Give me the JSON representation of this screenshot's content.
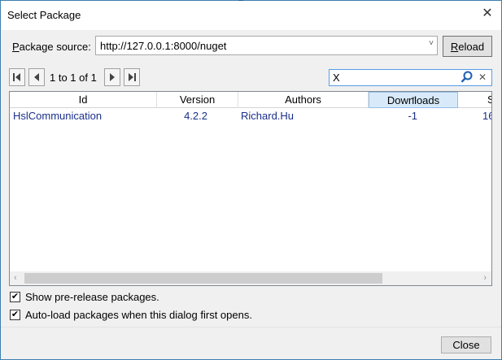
{
  "window": {
    "title": "Select Package",
    "close_glyph": "✕"
  },
  "source": {
    "label_prefix": "P",
    "label_rest": "ackage source:",
    "value": "http://127.0.0.1:8000/nuget",
    "dropdown_glyph": "˅",
    "reload_prefix": "R",
    "reload_rest": "eload"
  },
  "pager": {
    "first_glyph": "⏮",
    "prev_glyph": "◀",
    "text": "1 to 1 of 1",
    "next_glyph": "▶",
    "last_glyph": "⏭"
  },
  "search": {
    "value": "X",
    "clear_glyph": "✕"
  },
  "grid": {
    "columns": [
      "Id",
      "Version",
      "Authors",
      "Downloads",
      "S"
    ],
    "rows": [
      {
        "id": "HslCommunication",
        "version": "4.2.2",
        "authors": "Richard.Hu",
        "downloads": "-1",
        "extra": "16"
      }
    ],
    "scroll_left": "‹",
    "scroll_right": "›"
  },
  "options": {
    "show_prerelease": {
      "label": "Show pre-release packages.",
      "checked": true
    },
    "autoload": {
      "label": "Auto-load packages when this dialog first opens.",
      "checked": true
    },
    "check_glyph": "✔"
  },
  "footer": {
    "close_label": "Close"
  }
}
